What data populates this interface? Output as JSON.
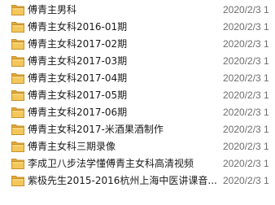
{
  "colors": {
    "folder_body": "#F3C75A",
    "folder_back": "#E0A93A",
    "folder_edge": "#C8922B",
    "name_text": "#1A1A1A",
    "date_text": "#6D6D6D"
  },
  "file_list": {
    "items": [
      {
        "icon": "folder-icon",
        "name": "傅青主男科",
        "date": "2020/2/3 1"
      },
      {
        "icon": "folder-icon",
        "name": "傅青主女科2016-01期",
        "date": "2020/2/3 1"
      },
      {
        "icon": "folder-icon",
        "name": "傅青主女科2017-02期",
        "date": "2020/2/3 1"
      },
      {
        "icon": "folder-icon",
        "name": "傅青主女科2017-03期",
        "date": "2020/2/3 1"
      },
      {
        "icon": "folder-icon",
        "name": "傅青主女科2017-04期",
        "date": "2020/2/3 1"
      },
      {
        "icon": "folder-icon",
        "name": "傅青主女科2017-05期",
        "date": "2020/2/3 1"
      },
      {
        "icon": "folder-icon",
        "name": "傅青主女科2017-06期",
        "date": "2020/2/3 1"
      },
      {
        "icon": "folder-icon",
        "name": "傅青主女科2017-米酒果酒制作",
        "date": "2020/2/3 1"
      },
      {
        "icon": "folder-icon",
        "name": "傅青主女科三期录像",
        "date": "2020/2/3 1"
      },
      {
        "icon": "folder-icon",
        "name": "李成卫八步法学懂傅青主女科高清视频",
        "date": "2020/2/3 1"
      },
      {
        "icon": "folder-icon",
        "name": "紫极先生2015-2016杭州上海中医讲课音...",
        "date": "2020/2/3 1"
      }
    ]
  }
}
